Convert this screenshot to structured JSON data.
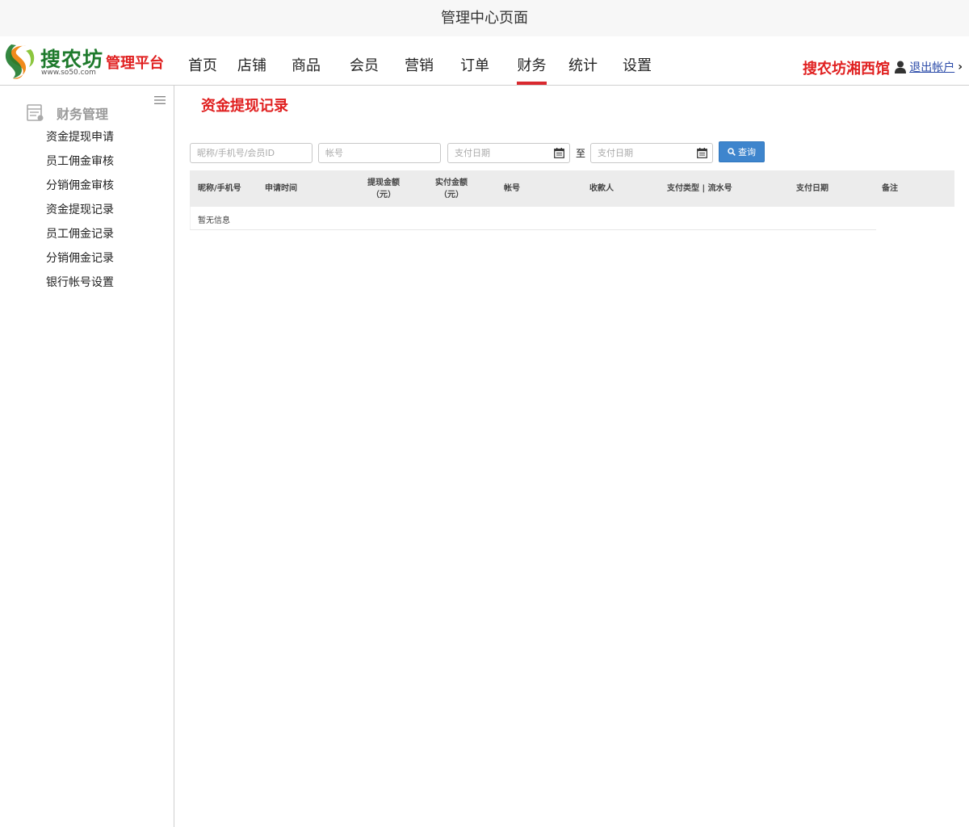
{
  "page_title": "管理中心页面",
  "brand": {
    "name": "搜农坊",
    "url": "www.so50.com",
    "platform": "管理平台",
    "colors": {
      "green": "#1e7a2c",
      "orange": "#f08a1c",
      "red": "#e02020"
    }
  },
  "nav": {
    "items": [
      {
        "label": "首页"
      },
      {
        "label": "店铺"
      },
      {
        "label": "商品"
      },
      {
        "label": "会员"
      },
      {
        "label": "营销"
      },
      {
        "label": "订单"
      },
      {
        "label": "财务",
        "active": true
      },
      {
        "label": "统计"
      },
      {
        "label": "设置"
      }
    ],
    "active_color": "#d9292f"
  },
  "account": {
    "store_name": "搜农坊湘西馆",
    "logout_label": "退出帐户",
    "user_icon": "user-icon",
    "chevron_icon": "chevron-right-icon"
  },
  "sidebar": {
    "section_title": "财务管理",
    "section_icon": "ledger-icon",
    "toggle_icon": "hamburger-menu-icon",
    "items": [
      {
        "label": "资金提现申请"
      },
      {
        "label": "员工佣金审核"
      },
      {
        "label": "分销佣金审核"
      },
      {
        "label": "资金提现记录"
      },
      {
        "label": "员工佣金记录"
      },
      {
        "label": "分销佣金记录"
      },
      {
        "label": "银行帐号设置"
      }
    ]
  },
  "main": {
    "title": "资金提现记录",
    "filters": {
      "member_placeholder": "昵称/手机号/会员ID",
      "account_placeholder": "帐号",
      "date_from_placeholder": "支付日期",
      "to_label": "至",
      "date_to_placeholder": "支付日期",
      "query_label": "查询",
      "calendar_icon": "calendar-icon",
      "search_icon": "search-icon",
      "button_color": "#3e85cd"
    },
    "table": {
      "headers": {
        "member": "昵称/手机号",
        "apply_time": "申请时间",
        "withdraw_amount_1": "提现金额",
        "withdraw_amount_2": "（元）",
        "paid_amount_1": "实付金额",
        "paid_amount_2": "（元）",
        "account": "帐号",
        "payee": "收款人",
        "pay_type": "支付类型 | 流水号",
        "pay_date": "支付日期",
        "remark": "备注"
      },
      "empty_text": "暂无信息"
    }
  }
}
